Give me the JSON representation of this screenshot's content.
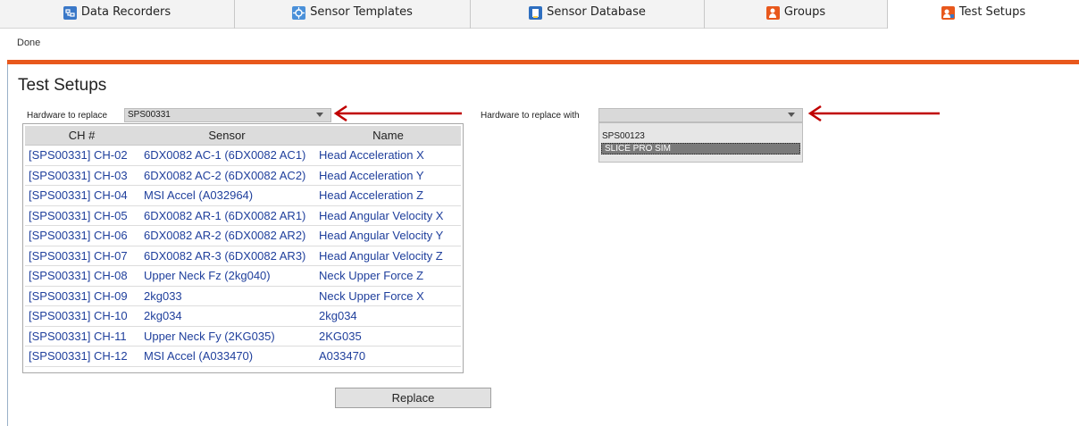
{
  "tabs": [
    {
      "label": "Data Recorders",
      "icon": "data-recorder-icon",
      "color": "#3a78c8"
    },
    {
      "label": "Sensor Templates",
      "icon": "sensor-template-icon",
      "color": "#4a90d9"
    },
    {
      "label": "Sensor Database",
      "icon": "sensor-database-icon",
      "color": "#2e6fc0"
    },
    {
      "label": "Groups",
      "icon": "groups-icon",
      "color": "#e8581c"
    },
    {
      "label": "Test Setups",
      "icon": "test-setups-icon",
      "color": "#e8581c"
    }
  ],
  "toolbar": {
    "done_label": "Done"
  },
  "accent_color": "#e8581c",
  "page_title": "Test Setups",
  "hw_replace": {
    "label": "Hardware to replace",
    "value": "SPS00331"
  },
  "hw_replace_with": {
    "label": "Hardware to replace with",
    "value": "",
    "options": [
      "SPS00123",
      "SLICE PRO SIM"
    ],
    "selected": "SLICE PRO SIM"
  },
  "grid": {
    "headers": [
      "CH #",
      "Sensor",
      "Name"
    ],
    "rows": [
      [
        "[SPS00331] CH-02",
        "6DX0082 AC-1 (6DX0082 AC1)",
        "Head Acceleration X"
      ],
      [
        "[SPS00331] CH-03",
        "6DX0082 AC-2 (6DX0082 AC2)",
        "Head Acceleration Y"
      ],
      [
        "[SPS00331] CH-04",
        "MSI Accel (A032964)",
        "Head Acceleration Z"
      ],
      [
        "[SPS00331] CH-05",
        "6DX0082 AR-1 (6DX0082 AR1)",
        "Head Angular Velocity X"
      ],
      [
        "[SPS00331] CH-06",
        "6DX0082 AR-2 (6DX0082 AR2)",
        "Head Angular Velocity Y"
      ],
      [
        "[SPS00331] CH-07",
        "6DX0082 AR-3 (6DX0082 AR3)",
        "Head Angular Velocity Z"
      ],
      [
        "[SPS00331] CH-08",
        "Upper Neck Fz (2kg040)",
        "Neck Upper Force Z"
      ],
      [
        "[SPS00331] CH-09",
        "2kg033",
        "Neck Upper Force X"
      ],
      [
        "[SPS00331] CH-10",
        "2kg034",
        "2kg034"
      ],
      [
        "[SPS00331] CH-11",
        "Upper Neck Fy (2KG035)",
        "2KG035"
      ],
      [
        "[SPS00331] CH-12",
        "MSI Accel (A033470)",
        "A033470"
      ]
    ]
  },
  "replace_button": {
    "label": "Replace"
  },
  "annotation_color": "#c00000"
}
